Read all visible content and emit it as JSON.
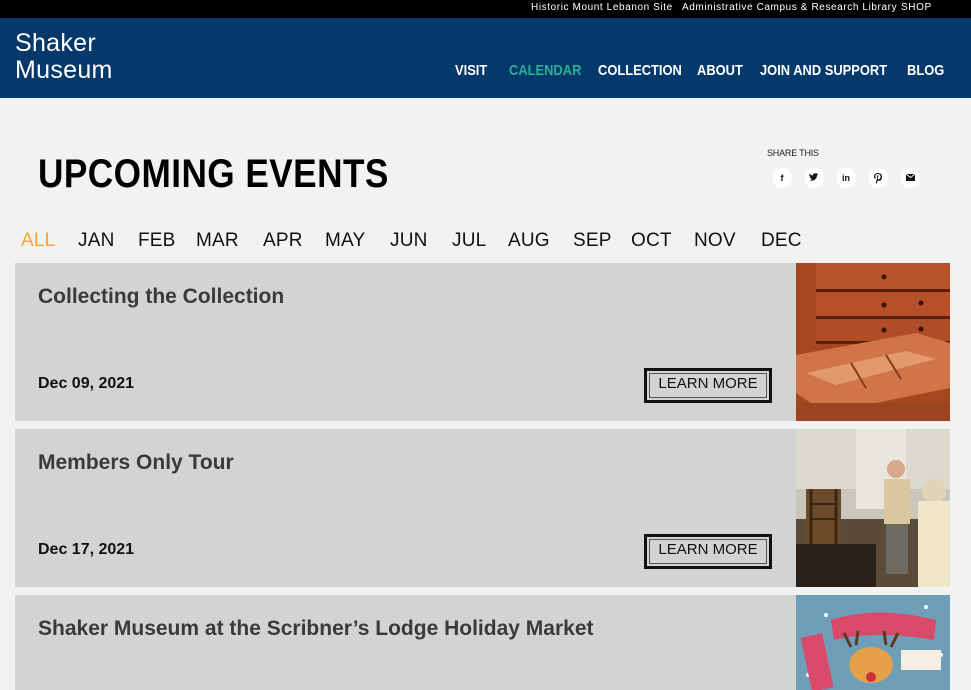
{
  "topbar": {
    "links": [
      "Historic Mount Lebanon Site",
      "Administrative Campus & Research Library",
      "SHOP"
    ]
  },
  "header": {
    "logo_line1": "Shaker",
    "logo_line2": "Museum",
    "nav": [
      "VISIT",
      "CALENDAR",
      "COLLECTION",
      "ABOUT",
      "JOIN AND SUPPORT",
      "BLOG"
    ],
    "active_nav": "CALENDAR"
  },
  "page": {
    "title": "UPCOMING EVENTS",
    "share_label": "SHARE THIS",
    "share_icons": [
      "facebook-icon",
      "twitter-icon",
      "linkedin-icon",
      "pinterest-icon",
      "email-icon"
    ]
  },
  "months": {
    "items": [
      "ALL",
      "JAN",
      "FEB",
      "MAR",
      "APR",
      "MAY",
      "JUN",
      "JUL",
      "AUG",
      "SEP",
      "OCT",
      "NOV",
      "DEC"
    ],
    "active": "ALL"
  },
  "events": [
    {
      "title": "Collecting the Collection",
      "date": "Dec 09, 2021",
      "button": "LEARN MORE"
    },
    {
      "title": "Members Only Tour",
      "date": "Dec 17, 2021",
      "button": "LEARN MORE"
    },
    {
      "title": "Shaker Museum at the Scribner’s Lodge Holiday Market",
      "date": "",
      "button": ""
    }
  ],
  "colors": {
    "header_bg": "#05386b",
    "active_nav": "#2ab094",
    "active_month": "#f5a623",
    "card_bg": "#d3d3d3"
  }
}
